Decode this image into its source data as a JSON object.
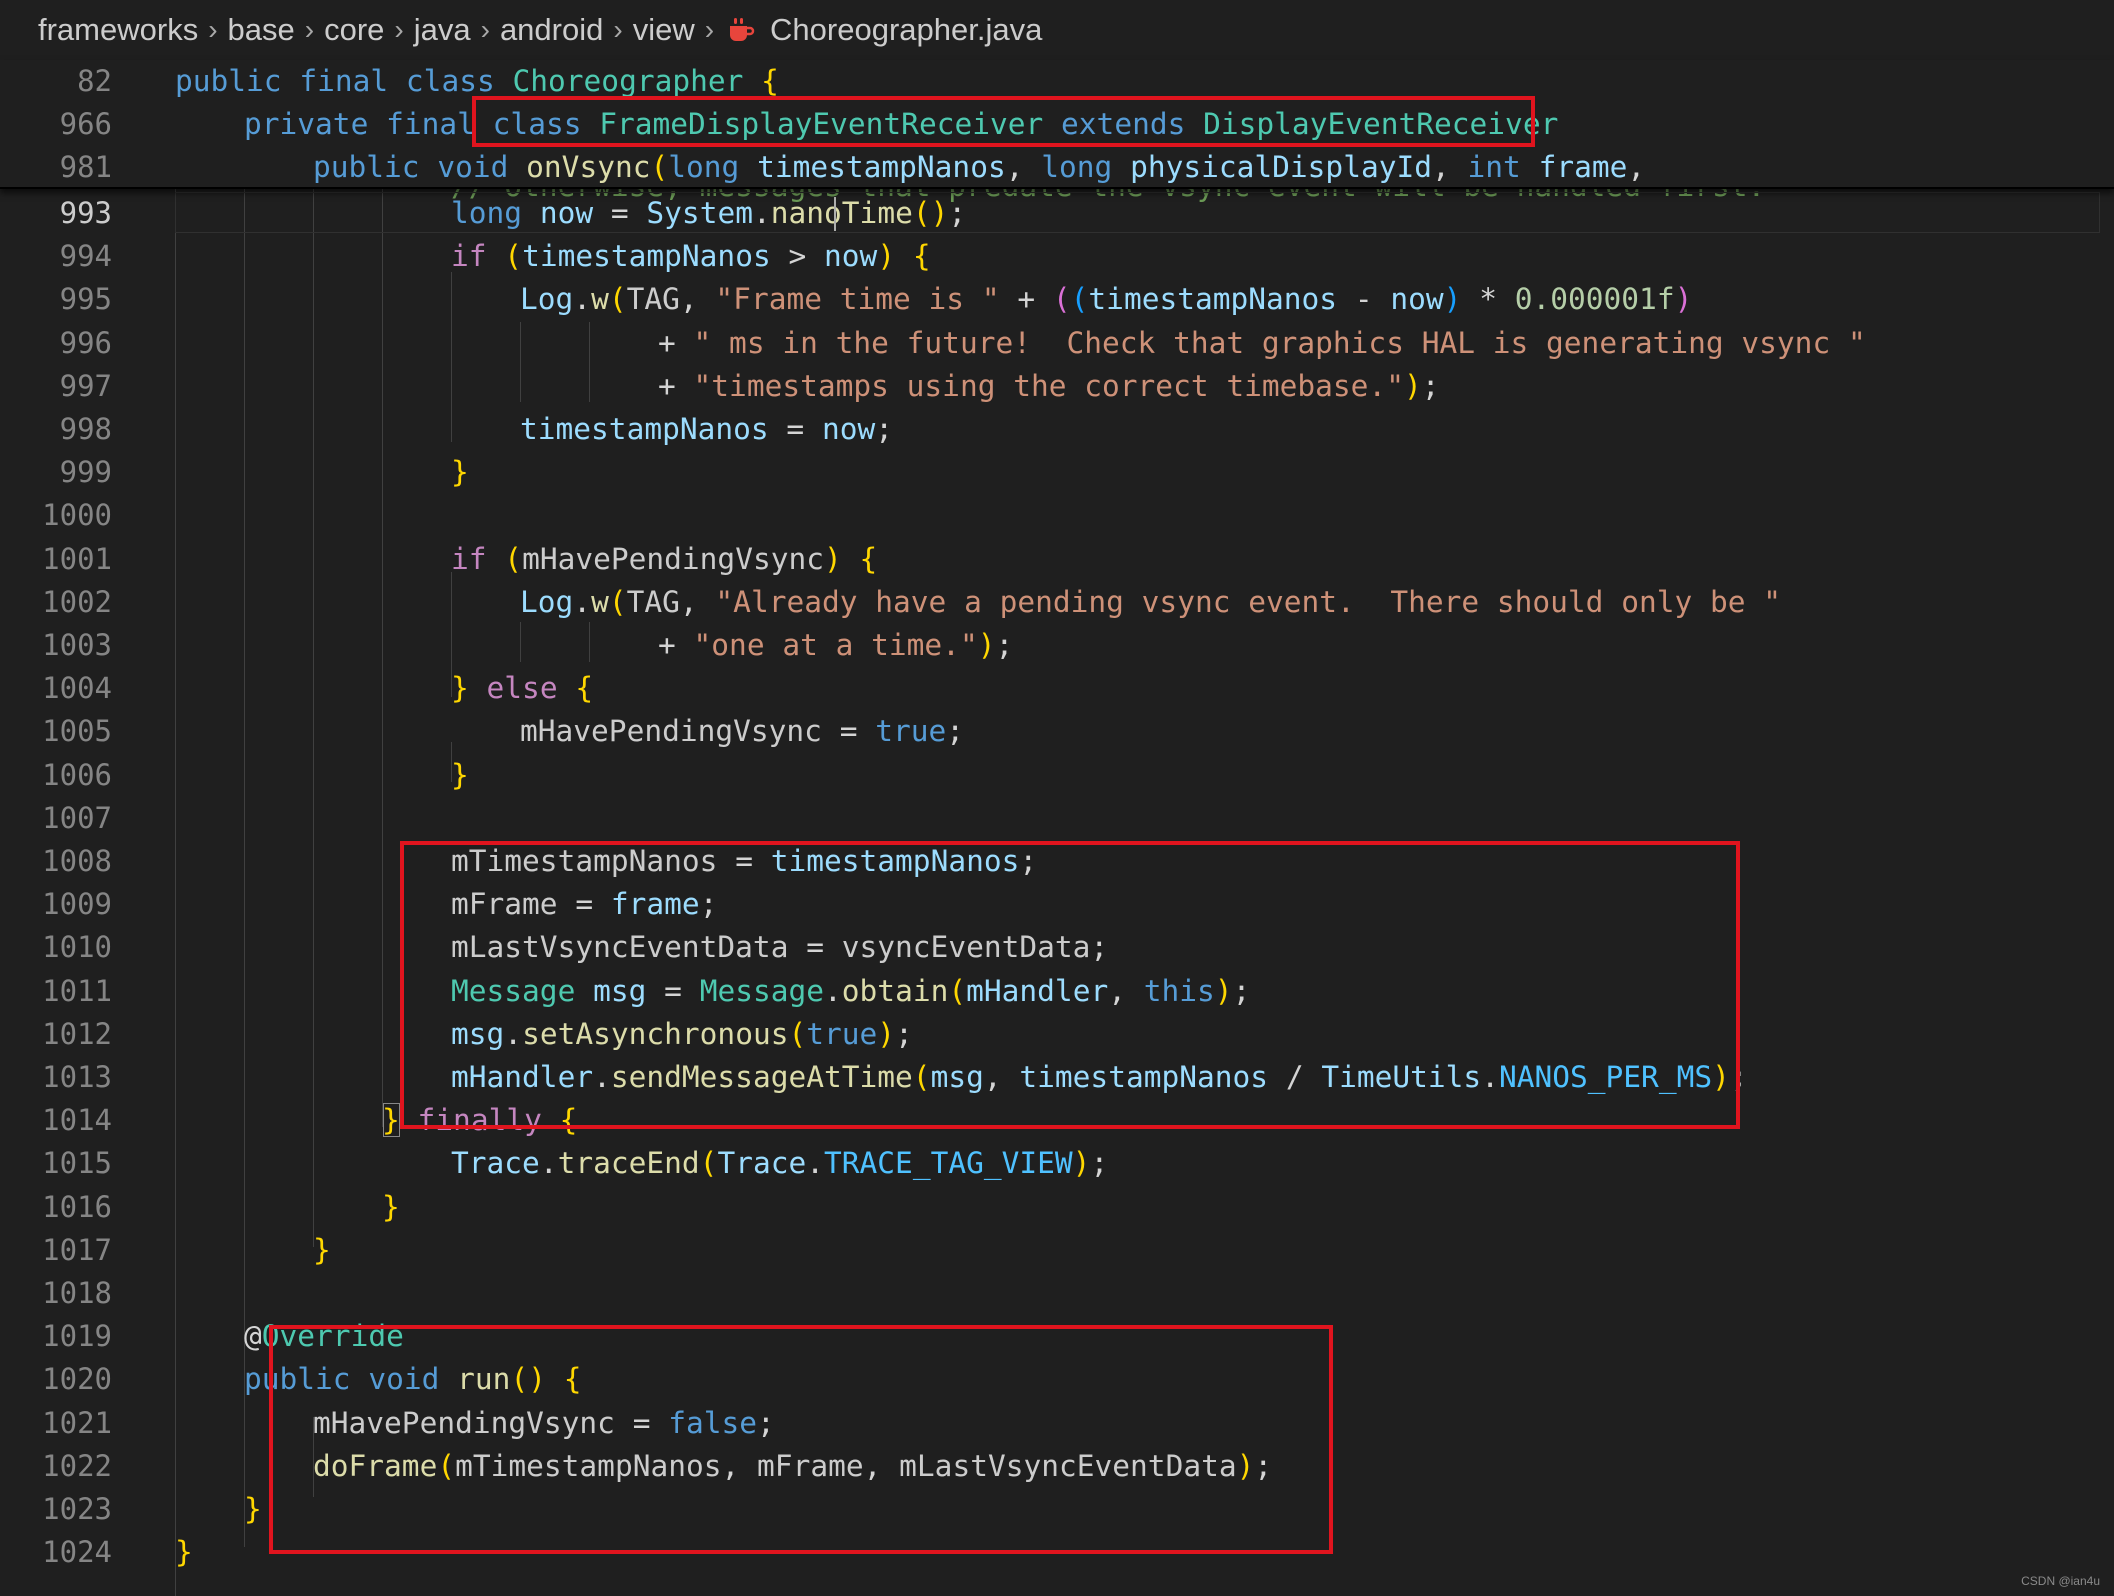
{
  "breadcrumb": {
    "items": [
      "frameworks",
      "base",
      "core",
      "java",
      "android",
      "view"
    ],
    "file": "Choreographer.java"
  },
  "sticky_lines": [
    {
      "num": "82",
      "text": "public final class Choreographer {"
    },
    {
      "num": "966",
      "text": "private final class FrameDisplayEventReceiver extends DisplayEventReceiver"
    },
    {
      "num": "981",
      "text": "public void onVsync(long timestampNanos, long physicalDisplayId, int frame,"
    }
  ],
  "partial_comment": "// Otherwise, messages that predate the vsync event will be handled first.",
  "lines": [
    {
      "num": "993",
      "text": "long now = System.nanoTime();"
    },
    {
      "num": "994",
      "text": "if (timestampNanos > now) {"
    },
    {
      "num": "995",
      "text": "Log.w(TAG, \"Frame time is \" + ((timestampNanos - now) * 0.000001f)"
    },
    {
      "num": "996",
      "text": "+ \" ms in the future!  Check that graphics HAL is generating vsync \""
    },
    {
      "num": "997",
      "text": "+ \"timestamps using the correct timebase.\");"
    },
    {
      "num": "998",
      "text": "timestampNanos = now;"
    },
    {
      "num": "999",
      "text": "}"
    },
    {
      "num": "1000",
      "text": ""
    },
    {
      "num": "1001",
      "text": "if (mHavePendingVsync) {"
    },
    {
      "num": "1002",
      "text": "Log.w(TAG, \"Already have a pending vsync event.  There should only be \""
    },
    {
      "num": "1003",
      "text": "+ \"one at a time.\");"
    },
    {
      "num": "1004",
      "text": "} else {"
    },
    {
      "num": "1005",
      "text": "mHavePendingVsync = true;"
    },
    {
      "num": "1006",
      "text": "}"
    },
    {
      "num": "1007",
      "text": ""
    },
    {
      "num": "1008",
      "text": "mTimestampNanos = timestampNanos;"
    },
    {
      "num": "1009",
      "text": "mFrame = frame;"
    },
    {
      "num": "1010",
      "text": "mLastVsyncEventData = vsyncEventData;"
    },
    {
      "num": "1011",
      "text": "Message msg = Message.obtain(mHandler, this);"
    },
    {
      "num": "1012",
      "text": "msg.setAsynchronous(true);"
    },
    {
      "num": "1013",
      "text": "mHandler.sendMessageAtTime(msg, timestampNanos / TimeUtils.NANOS_PER_MS);"
    },
    {
      "num": "1014",
      "text": "} finally {"
    },
    {
      "num": "1015",
      "text": "Trace.traceEnd(Trace.TRACE_TAG_VIEW);"
    },
    {
      "num": "1016",
      "text": "}"
    },
    {
      "num": "1017",
      "text": "}"
    },
    {
      "num": "1018",
      "text": ""
    },
    {
      "num": "1019",
      "text": "@Override"
    },
    {
      "num": "1020",
      "text": "public void run() {"
    },
    {
      "num": "1021",
      "text": "mHavePendingVsync = false;"
    },
    {
      "num": "1022",
      "text": "doFrame(mTimestampNanos, mFrame, mLastVsyncEventData);"
    },
    {
      "num": "1023",
      "text": "}"
    },
    {
      "num": "1024",
      "text": "}"
    }
  ],
  "watermark": "CSDN @ian4u",
  "colors": {
    "background": "#1f1f1f",
    "highlight_box": "#e0141e",
    "keyword": "#569cd6",
    "type": "#4ec9b0",
    "string": "#ce9178",
    "function": "#dcdcaa",
    "variable": "#9cdcfe"
  },
  "icons": {
    "file_icon": "java-coffee-cup-icon",
    "separator": "chevron-right-icon"
  }
}
